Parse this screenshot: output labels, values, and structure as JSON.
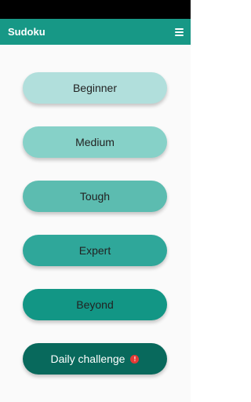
{
  "app_bar": {
    "title": "Sudoku",
    "menu_icon": "hamburger-menu-icon"
  },
  "levels": [
    {
      "label": "Beginner",
      "color": "#b1dfdc"
    },
    {
      "label": "Medium",
      "color": "#86d1c8"
    },
    {
      "label": "Tough",
      "color": "#5cbcb0"
    },
    {
      "label": "Expert",
      "color": "#2fa79a"
    },
    {
      "label": "Beyond",
      "color": "#129685"
    }
  ],
  "daily_challenge": {
    "label": "Daily challenge",
    "color": "#08695c",
    "alert_icon": "alert-icon",
    "alert_glyph": "!",
    "alert_color": "#e53935"
  },
  "theme": {
    "app_bar_color": "#179886"
  }
}
